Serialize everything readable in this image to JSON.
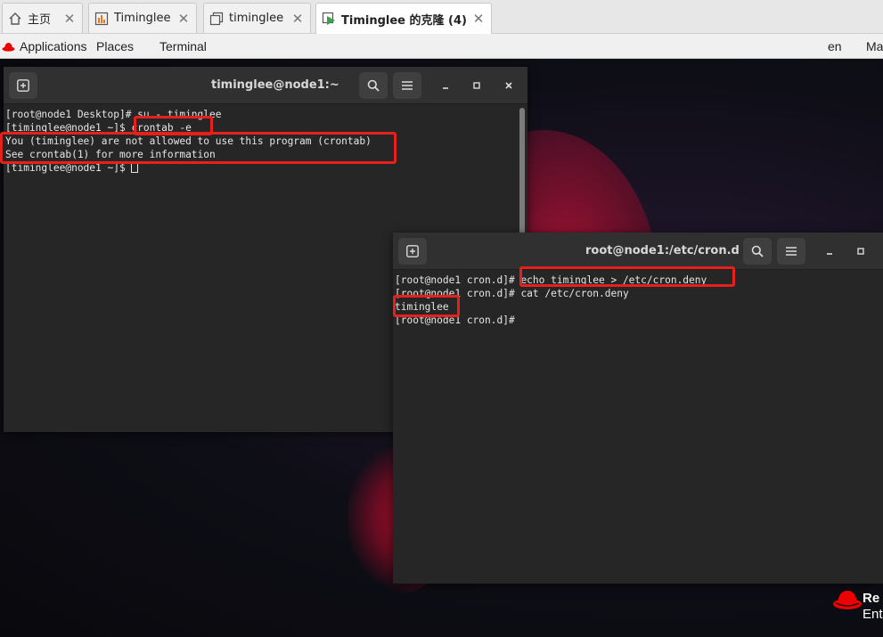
{
  "vm_tabs": [
    {
      "label": "主页",
      "icon": "home-icon",
      "active": false
    },
    {
      "label": "Timinglee",
      "icon": "vm-running-icon",
      "active": false
    },
    {
      "label": "timinglee",
      "icon": "vm-clone-icon",
      "active": false
    },
    {
      "label": "Timinglee 的克隆 (4)",
      "icon": "vm-play-icon",
      "active": true
    }
  ],
  "topbar": {
    "applications": "Applications",
    "places": "Places",
    "terminal": "Terminal",
    "language": "en",
    "right_cut": "Ma"
  },
  "terminal1": {
    "title": "timinglee@node1:~",
    "lines": [
      "[root@node1 Desktop]# su - timinglee",
      "[timinglee@node1 ~]$ crontab -e",
      "You (timinglee) are not allowed to use this program (crontab)",
      "See crontab(1) for more information",
      "[timinglee@node1 ~]$ "
    ]
  },
  "terminal2": {
    "title": "root@node1:/etc/cron.d",
    "lines": [
      "[root@node1 cron.d]# echo timinglee > /etc/cron.deny",
      "[root@node1 cron.d]# cat /etc/cron.deny",
      "timinglee",
      "[root@node1 cron.d]# "
    ]
  },
  "logo": {
    "line1": "Re",
    "line2": "Ent"
  },
  "colors": {
    "highlight": "#e8201c",
    "terminal_bg": "#262626",
    "redhat_red": "#ee0000"
  }
}
